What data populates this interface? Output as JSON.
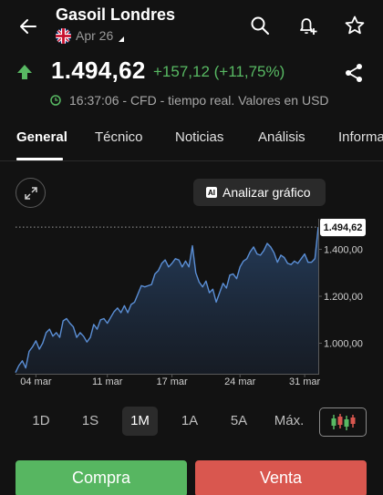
{
  "header": {
    "title": "Gasoil Londres",
    "date": "Apr 26"
  },
  "quote": {
    "price": "1.494,62",
    "change": "+157,12 (+11,75%)",
    "time_info": "16:37:06 - CFD - tiempo real. Valores en USD",
    "direction": "up",
    "up_color": "#58b963"
  },
  "tabs": [
    {
      "label": "General"
    },
    {
      "label": "Técnico"
    },
    {
      "label": "Noticias"
    },
    {
      "label": "Análisis"
    },
    {
      "label": "Informa"
    }
  ],
  "active_tab": "General",
  "actions": {
    "analyze_label": "Analizar gráfico",
    "ai_badge": "AI"
  },
  "chart_data": {
    "type": "area",
    "x_ticks": [
      "04 mar",
      "11 mar",
      "17 mar",
      "24 mar",
      "31 mar"
    ],
    "y_ticks": [
      {
        "label": "1.400,00",
        "value": 1400
      },
      {
        "label": "1.200,00",
        "value": 1200
      },
      {
        "label": "1.000,00",
        "value": 1000
      }
    ],
    "last_label": "1.494,62",
    "last_value": 1494.62,
    "ylim": [
      870,
      1530
    ],
    "line_color": "#5b8fd6",
    "values": [
      875,
      905,
      925,
      895,
      965,
      985,
      1010,
      975,
      1000,
      1045,
      1060,
      1030,
      1045,
      1025,
      1095,
      1105,
      1085,
      1070,
      1025,
      1045,
      1030,
      1005,
      1025,
      1080,
      1060,
      1100,
      1105,
      1085,
      1110,
      1135,
      1150,
      1130,
      1160,
      1130,
      1165,
      1175,
      1210,
      1245,
      1240,
      1245,
      1250,
      1295,
      1310,
      1340,
      1355,
      1325,
      1340,
      1360,
      1355,
      1325,
      1350,
      1325,
      1415,
      1300,
      1260,
      1240,
      1265,
      1215,
      1230,
      1175,
      1215,
      1255,
      1235,
      1290,
      1295,
      1275,
      1325,
      1350,
      1360,
      1390,
      1410,
      1380,
      1375,
      1395,
      1425,
      1410,
      1385,
      1345,
      1375,
      1365,
      1340,
      1335,
      1350,
      1340,
      1360,
      1380,
      1345,
      1345,
      1360,
      1494.62
    ]
  },
  "ranges": [
    "1D",
    "1S",
    "1M",
    "1A",
    "5A",
    "Máx."
  ],
  "active_range": "1M",
  "trade": {
    "buy_label": "Compra",
    "sell_label": "Venta",
    "buy_color": "#57b661",
    "sell_color": "#d9574f"
  }
}
